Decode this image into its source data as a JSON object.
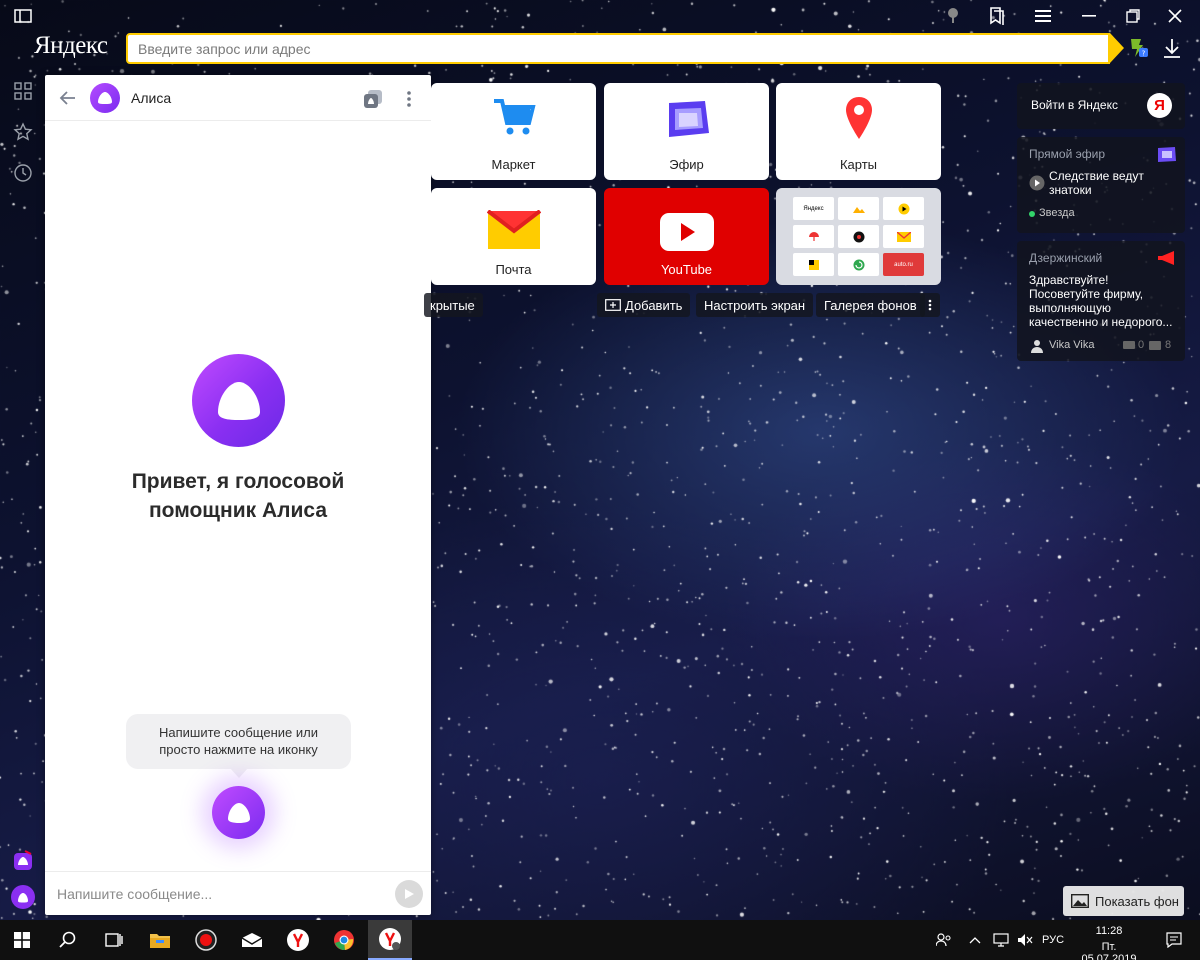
{
  "browser": {
    "logo": "Яндекс",
    "address_placeholder": "Введите запрос или адрес"
  },
  "alice": {
    "title": "Алиса",
    "greeting_line1": "Привет, я голосовой",
    "greeting_line2": "помощник Алиса",
    "hint_line1": "Напишите сообщение или",
    "hint_line2": "просто нажмите на иконку",
    "input_placeholder": "Напишите сообщение..."
  },
  "tiles": [
    {
      "label": "Маркет"
    },
    {
      "label": "Эфир"
    },
    {
      "label": "Карты"
    },
    {
      "label": "Почта"
    },
    {
      "label": "YouTube"
    }
  ],
  "collection_minis": [
    "Яндекс",
    "auto.ru"
  ],
  "bottom_bar": {
    "hidden": "крытые",
    "add": "Добавить",
    "customize": "Настроить экран",
    "gallery": "Галерея фонов"
  },
  "widgets": {
    "login": "Войти в Яндекс",
    "login_badge": "Я",
    "efir_head": "Прямой эфир",
    "efir_show_line1": "Следствие ведут",
    "efir_show_line2": "знатоки",
    "efir_channel": "Звезда",
    "news_head": "Дзержинский",
    "news_line1": "Здравствуйте!",
    "news_line2": "Посоветуйте фирму,",
    "news_line3": "выполняющую",
    "news_line4": "качественно и недорого...",
    "news_author": "Vika Vika",
    "news_count1": "0",
    "news_count2": "8"
  },
  "show_bg": "Показать фон",
  "taskbar": {
    "lang": "РУС",
    "time": "11:28",
    "date": "Пт. 05.07.2019"
  },
  "colors": {
    "accent_yellow": "#ffcc00",
    "alice_purple": "#8a2ff2",
    "youtube_red": "#e00000"
  }
}
